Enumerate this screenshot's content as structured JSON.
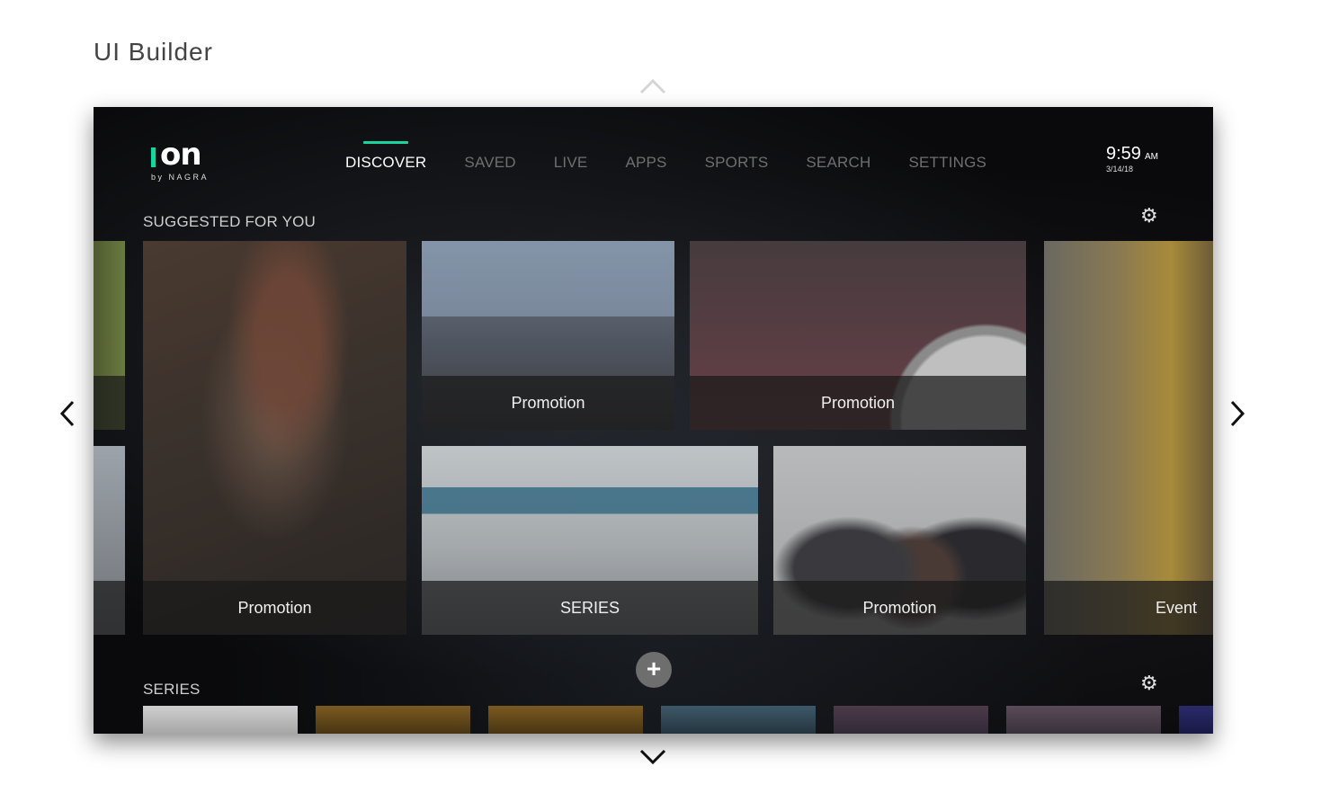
{
  "page": {
    "title": "UI Builder"
  },
  "logo": {
    "mark": "on",
    "subtitle": "by NAGRA"
  },
  "nav": {
    "tabs": [
      {
        "label": "DISCOVER",
        "active": true
      },
      {
        "label": "SAVED"
      },
      {
        "label": "LIVE"
      },
      {
        "label": "APPS"
      },
      {
        "label": "SPORTS"
      },
      {
        "label": "SEARCH"
      },
      {
        "label": "SETTINGS"
      }
    ]
  },
  "clock": {
    "time": "9:59",
    "ampm": "AM",
    "date": "3/14/18"
  },
  "suggested": {
    "title": "SUGGESTED FOR YOU",
    "tiles": [
      {
        "label": "Promotion"
      },
      {
        "label": "Promotion"
      },
      {
        "label": "Promotion"
      },
      {
        "label": "SERIES"
      },
      {
        "label": "Promotion"
      },
      {
        "label": "Event"
      }
    ]
  },
  "series": {
    "title": "SERIES"
  },
  "icons": {
    "settings": "gear-icon",
    "add": "plus-icon",
    "scroll_up": "chevron-up-icon",
    "scroll_down": "chevron-down-icon",
    "prev": "chevron-left-icon",
    "next": "chevron-right-icon"
  },
  "colors": {
    "accent": "#1ad4a0",
    "screen_bg": "#050505"
  }
}
